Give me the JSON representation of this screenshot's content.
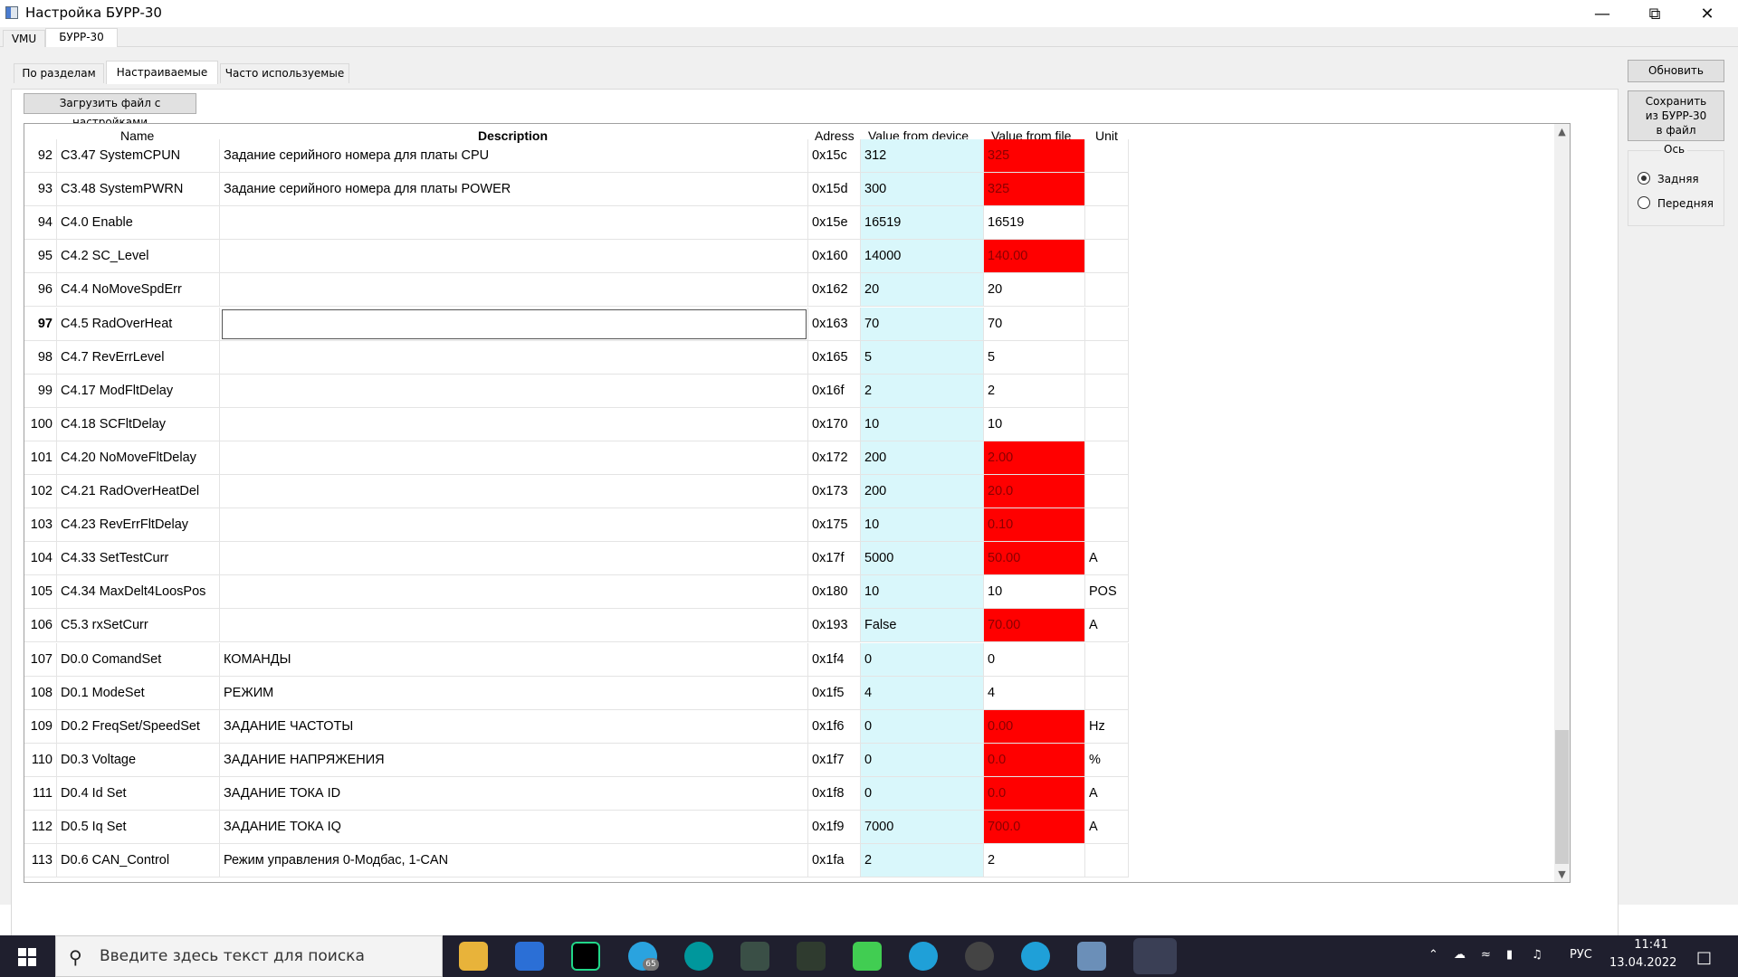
{
  "window": {
    "title": "Настройка БУРР-30"
  },
  "outer_tabs": [
    "VMU",
    "БУРР-30"
  ],
  "inner_tabs": [
    "По разделам",
    "Настраиваемые",
    "Часто используемые"
  ],
  "load_button": "Загрузить файл с настройками",
  "side": {
    "refresh_button": "Обновить",
    "save_button_lines": [
      "Сохранить",
      "из БУРР-30",
      "в файл"
    ],
    "axis_group": "Ось",
    "axis_options": [
      "Задняя",
      "Передняя"
    ],
    "axis_selected": "Задняя"
  },
  "table": {
    "headers": {
      "name": "Name",
      "description": "Description",
      "address": "Adress",
      "device": "Value from device",
      "file": "Value from file",
      "unit": "Unit"
    },
    "rows": [
      {
        "num": "92",
        "name": "C3.47 SystemCPUN",
        "desc": "Задание серийного номера для платы CPU",
        "addr": "0x15c",
        "dev": "312",
        "file": "325",
        "diff": true,
        "unit": ""
      },
      {
        "num": "93",
        "name": "C3.48 SystemPWRN",
        "desc": "Задание серийного номера для платы POWER",
        "addr": "0x15d",
        "dev": "300",
        "file": "325",
        "diff": true,
        "unit": ""
      },
      {
        "num": "94",
        "name": "C4.0 Enable",
        "desc": "",
        "addr": "0x15e",
        "dev": "16519",
        "file": "16519",
        "diff": false,
        "unit": ""
      },
      {
        "num": "95",
        "name": "C4.2 SC_Level",
        "desc": "",
        "addr": "0x160",
        "dev": "14000",
        "file": "140.00",
        "diff": true,
        "unit": ""
      },
      {
        "num": "96",
        "name": "C4.4 NoMoveSpdErr",
        "desc": "",
        "addr": "0x162",
        "dev": "20",
        "file": "20",
        "diff": false,
        "unit": ""
      },
      {
        "num": "97",
        "name": "C4.5 RadOverHeat",
        "desc": "",
        "addr": "0x163",
        "dev": "70",
        "file": "70",
        "diff": false,
        "unit": "",
        "selected": true
      },
      {
        "num": "98",
        "name": "C4.7 RevErrLevel",
        "desc": "",
        "addr": "0x165",
        "dev": "5",
        "file": "5",
        "diff": false,
        "unit": ""
      },
      {
        "num": "99",
        "name": "C4.17 ModFltDelay",
        "desc": "",
        "addr": "0x16f",
        "dev": "2",
        "file": "2",
        "diff": false,
        "unit": ""
      },
      {
        "num": "100",
        "name": "C4.18 SCFltDelay",
        "desc": "",
        "addr": "0x170",
        "dev": "10",
        "file": "10",
        "diff": false,
        "unit": ""
      },
      {
        "num": "101",
        "name": "C4.20 NoMoveFltDelay",
        "desc": "",
        "addr": "0x172",
        "dev": "200",
        "file": "2.00",
        "diff": true,
        "unit": ""
      },
      {
        "num": "102",
        "name": "C4.21 RadOverHeatDel",
        "desc": "",
        "addr": "0x173",
        "dev": "200",
        "file": "20.0",
        "diff": true,
        "unit": ""
      },
      {
        "num": "103",
        "name": "C4.23 RevErrFltDelay",
        "desc": "",
        "addr": "0x175",
        "dev": "10",
        "file": "0.10",
        "diff": true,
        "unit": ""
      },
      {
        "num": "104",
        "name": "C4.33 SetTestCurr",
        "desc": "",
        "addr": "0x17f",
        "dev": "5000",
        "file": "50.00",
        "diff": true,
        "unit": "A"
      },
      {
        "num": "105",
        "name": "C4.34 MaxDelt4LoosPos",
        "desc": "",
        "addr": "0x180",
        "dev": "10",
        "file": "10",
        "diff": false,
        "unit": "POS"
      },
      {
        "num": "106",
        "name": "C5.3 rxSetCurr",
        "desc": "",
        "addr": "0x193",
        "dev": "False",
        "file": "70.00",
        "diff": true,
        "unit": "A"
      },
      {
        "num": "107",
        "name": "D0.0 ComandSet",
        "desc": "КОМАНДЫ",
        "addr": "0x1f4",
        "dev": "0",
        "file": "0",
        "diff": false,
        "unit": ""
      },
      {
        "num": "108",
        "name": "D0.1 ModeSet",
        "desc": "РЕЖИМ",
        "addr": "0x1f5",
        "dev": "4",
        "file": "4",
        "diff": false,
        "unit": ""
      },
      {
        "num": "109",
        "name": "D0.2 FreqSet/SpeedSet",
        "desc": "ЗАДАНИЕ ЧАСТОТЫ",
        "addr": "0x1f6",
        "dev": "0",
        "file": "0.00",
        "diff": true,
        "unit": "Hz"
      },
      {
        "num": "110",
        "name": "D0.3 Voltage",
        "desc": "ЗАДАНИЕ НАПРЯЖЕНИЯ",
        "addr": "0x1f7",
        "dev": "0",
        "file": "0.0",
        "diff": true,
        "unit": "%"
      },
      {
        "num": "111",
        "name": "D0.4 Id Set",
        "desc": "ЗАДАНИЕ ТОКА ID",
        "addr": "0x1f8",
        "dev": "0",
        "file": "0.0",
        "diff": true,
        "unit": "A"
      },
      {
        "num": "112",
        "name": "D0.5 Iq Set",
        "desc": "ЗАДАНИЕ ТОКА IQ",
        "addr": "0x1f9",
        "dev": "7000",
        "file": "700.0",
        "diff": true,
        "unit": "A"
      },
      {
        "num": "113",
        "name": "D0.6 CAN_Control",
        "desc": "Режим управления 0-Модбас, 1-CAN",
        "addr": "0x1fa",
        "dev": "2",
        "file": "2",
        "diff": false,
        "unit": ""
      }
    ]
  },
  "taskbar": {
    "search_placeholder": "Введите здесь текст для поиска",
    "telegram_badge": "65",
    "language": "РУС",
    "time": "11:41",
    "date": "13.04.2022"
  }
}
